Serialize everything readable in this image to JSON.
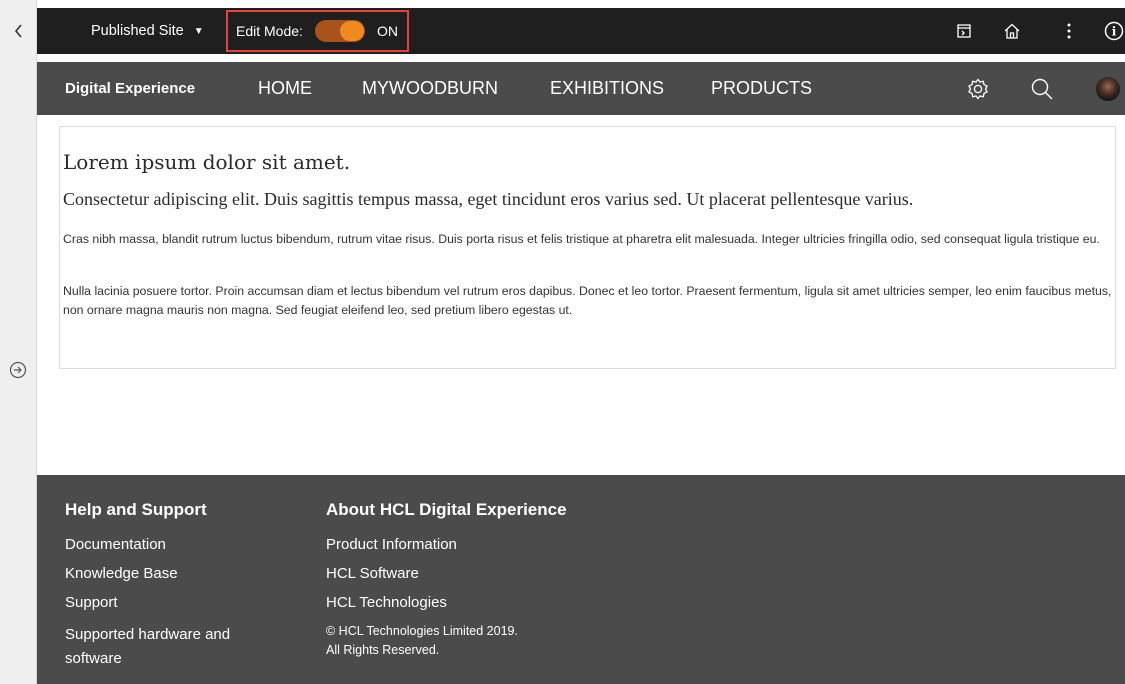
{
  "toolbar": {
    "site_selector": "Published Site",
    "edit_mode_label": "Edit Mode:",
    "edit_mode_state": "ON",
    "icons": [
      "back-chevron-icon",
      "panel-toggle-icon",
      "home-icon",
      "more-vertical-icon",
      "info-icon"
    ]
  },
  "nav": {
    "brand": "Digital Experience",
    "items": [
      "HOME",
      "MYWOODBURN",
      "EXHIBITIONS",
      "PRODUCTS"
    ],
    "icons": [
      "settings-icon",
      "search-icon",
      "user-avatar"
    ]
  },
  "content": {
    "title": "Lorem ipsum dolor sit amet.",
    "subtitle": "Consectetur adipiscing elit. Duis sagittis tempus massa, eget tincidunt eros varius sed. Ut placerat pellentesque varius.",
    "paragraphs": [
      "Cras nibh massa, blandit rutrum luctus bibendum, rutrum vitae risus. Duis porta risus et felis tristique at pharetra elit malesuada. Integer ultricies fringilla odio, sed consequat ligula tristique eu.",
      "Nulla lacinia posuere tortor. Proin accumsan diam et lectus bibendum vel rutrum eros dapibus. Donec et leo tortor. Praesent fermentum, ligula sit amet ultricies semper, leo enim faucibus metus, non ornare magna mauris non magna. Sed feugiat eleifend leo, sed pretium libero egestas ut."
    ]
  },
  "footer": {
    "col1": {
      "heading": "Help and Support",
      "links": [
        "Documentation",
        "Knowledge Base",
        "Support",
        "Supported hardware and software"
      ]
    },
    "col2": {
      "heading": "About HCL Digital Experience",
      "links": [
        "Product Information",
        "HCL Software",
        "HCL Technologies"
      ],
      "copyright": "© HCL Technologies Limited 2019.",
      "rights": "All Rights Reserved."
    }
  },
  "colors": {
    "toolbar_bg": "#1f1f1f",
    "nav_bg": "#4b4b4b",
    "toggle_on": "#f18a1e",
    "highlight_border": "#e8413a"
  }
}
